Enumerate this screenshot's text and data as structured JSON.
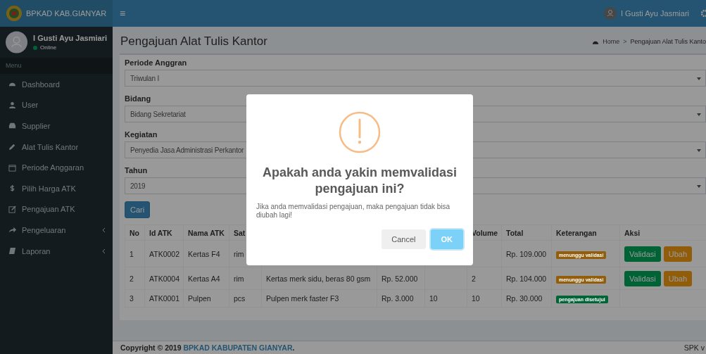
{
  "header": {
    "brand": "BPKAD KAB.GIANYAR",
    "menu_toggle": "≡",
    "user_name": "I Gusti Ayu Jasmiari"
  },
  "sidebar": {
    "user_name": "I Gusti Ayu Jasmiari",
    "status": "Online",
    "section": "Menu",
    "items": [
      {
        "label": "Dashboard",
        "has_submenu": false
      },
      {
        "label": "User",
        "has_submenu": false
      },
      {
        "label": "Supplier",
        "has_submenu": false
      },
      {
        "label": "Alat Tulis Kantor",
        "has_submenu": false
      },
      {
        "label": "Periode Anggaran",
        "has_submenu": false
      },
      {
        "label": "Pilih Harga ATK",
        "has_submenu": false
      },
      {
        "label": "Pengajuan ATK",
        "has_submenu": false
      },
      {
        "label": "Pengeluaran",
        "has_submenu": true
      },
      {
        "label": "Laporan",
        "has_submenu": true
      }
    ]
  },
  "page": {
    "title": "Pengajuan Alat Tulis Kantor",
    "breadcrumb": [
      "Home",
      "Pengajuan Alat Tulis Kanto"
    ],
    "breadcrumb_separator": ">"
  },
  "form": {
    "fields": [
      {
        "label": "Periode Anggran",
        "value": "Triwulan I"
      },
      {
        "label": "Bidang",
        "value": "Bidang Sekretariat"
      },
      {
        "label": "Kegiatan",
        "value": "Penyedia Jasa Administrasi Perkantor"
      },
      {
        "label": "Tahun",
        "value": "2019"
      }
    ],
    "search_button": "Cari"
  },
  "table": {
    "columns": [
      {
        "label": "No"
      },
      {
        "label": "Id ATK"
      },
      {
        "label": "Nama ATK"
      },
      {
        "label": "Sat"
      },
      {},
      {},
      {},
      {
        "label": "Volume"
      },
      {
        "label": "Total"
      },
      {
        "label": "Keterangan"
      },
      {
        "label": "Aksi"
      }
    ],
    "rows": [
      {
        "cells": [
          "1",
          "ATK0002",
          "Kertas F4",
          "rim",
          null,
          null,
          null,
          null,
          "Rp. 109.000"
        ],
        "status": {
          "text": "menunggu validasi",
          "color": "#925e0b"
        },
        "actions": [
          {
            "label": "Validasi",
            "kind": "validate"
          },
          {
            "label": "Ubah",
            "kind": "edit"
          }
        ]
      },
      {
        "cells": [
          "2",
          "ATK0004",
          "Kertas A4",
          "rim",
          "Kertas merk sidu, beras 80 gsm",
          "Rp. 52.000",
          null,
          "2",
          "Rp. 104.000"
        ],
        "status": {
          "text": "menunggu validasi",
          "color": "#925e0b"
        },
        "actions": [
          {
            "label": "Validasi",
            "kind": "validate"
          },
          {
            "label": "Ubah",
            "kind": "edit"
          }
        ]
      },
      {
        "cells": [
          "3",
          "ATK0001",
          "Pulpen",
          "pcs",
          "Pulpen merk faster F3",
          "Rp. 3.000",
          "10",
          "10",
          "Rp. 30.000"
        ],
        "status": {
          "text": "pengajuan disetujui",
          "color": "#006436"
        },
        "actions": []
      }
    ]
  },
  "footer": {
    "copyright": "Copyright © 2019",
    "link": "BPKAD KABUPATEN GIANYAR",
    "end": ".",
    "version": "SPK v"
  },
  "dialog": {
    "title": "Apakah anda yakin memvalidasi pengajuan ini?",
    "text": "Jika anda memvalidasi pengajuan, maka pengajuan tidak bisa diubah lagi!",
    "buttons": [
      {
        "label": "Cancel",
        "kind": "cancel"
      },
      {
        "label": "OK",
        "kind": "confirm"
      }
    ]
  }
}
